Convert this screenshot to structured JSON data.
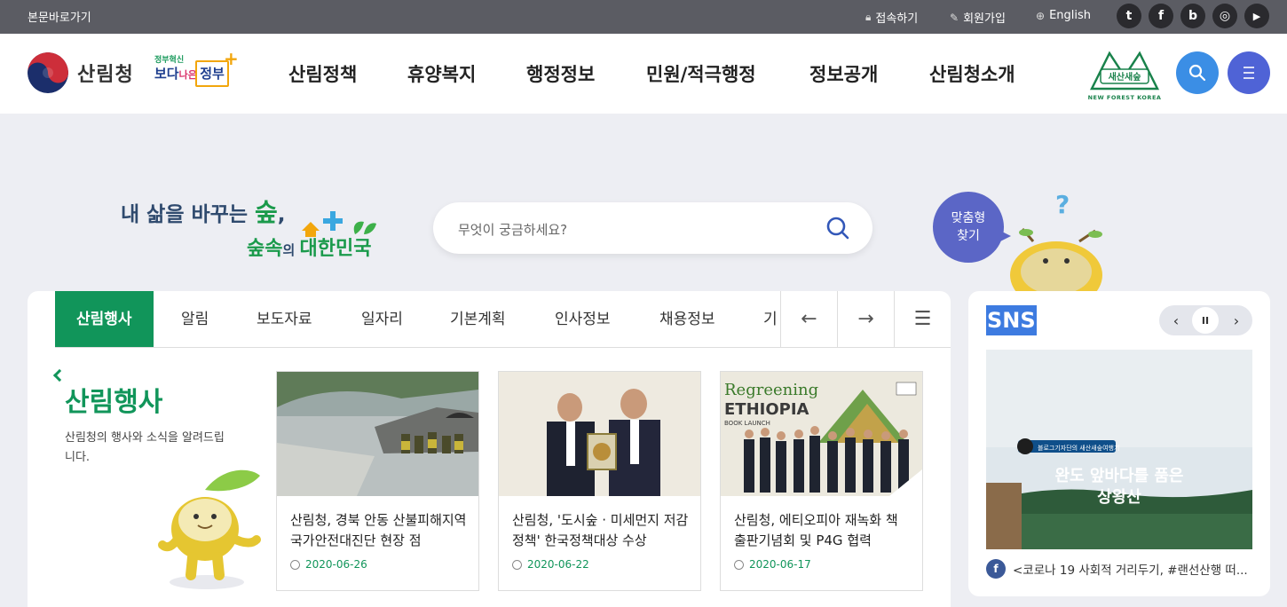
{
  "topbar": {
    "skip_link": "본문바로가기",
    "login": "접속하기",
    "signup": "회원가입",
    "english": "English",
    "social": [
      {
        "name": "twitter",
        "glyph": "t"
      },
      {
        "name": "facebook",
        "glyph": "f"
      },
      {
        "name": "blog",
        "glyph": "b"
      },
      {
        "name": "instagram",
        "glyph": "◎"
      },
      {
        "name": "youtube",
        "glyph": "▶"
      }
    ]
  },
  "header": {
    "logo_text": "산림청",
    "gov_small": "정부혁신",
    "gov_big_1": "보다",
    "gov_big_2": "나은",
    "gov_bracket": "정부",
    "gov_plus": "+",
    "menu": [
      "산림정책",
      "휴양복지",
      "행정정보",
      "민원/적극행정",
      "정보공개",
      "산림청소개"
    ],
    "badge_name": "새산새숲",
    "badge_sub": "NEW FOREST KOREA",
    "search_icon": "search-icon",
    "menu_icon": "hamburger-menu-icon",
    "search_button_color": "#3b8ee5",
    "menu_button_color": "#4f63d6"
  },
  "hero": {
    "slogan_a": "내 삶을 바꾸는 ",
    "slogan_b": "숲",
    "slogan_c": ",",
    "slogan_line2_a": "숲속",
    "slogan_line2_b": "의 ",
    "slogan_line2_c": "대한민국",
    "search_placeholder": "무엇이 궁금하세요?",
    "custom_finder": "맞춤형\n찾기",
    "custom_finder_line1": "맞춤형",
    "custom_finder_line2": "찾기",
    "qmark": "?"
  },
  "board": {
    "tabs": [
      "산림행사",
      "알림",
      "보도자료",
      "일자리",
      "기본계획",
      "인사정보",
      "채용정보",
      "기"
    ],
    "active_tab": "산림행사",
    "prev_icon": "arrow-left-icon",
    "next_icon": "arrow-right-icon",
    "list_icon": "list-icon",
    "prev_glyph": "←",
    "next_glyph": "→",
    "list_glyph": "☰",
    "title": "산림행사",
    "description": "산림청의 행사와 소식을 알려드립니다.",
    "cards": [
      {
        "title": "산림청, 경북 안동 산불피해지역 국가안전대진단 현장 점",
        "date": "2020-06-26"
      },
      {
        "title": "산림청, '도시숲 · 미세먼지 저감 정책' 한국정책대상 수상",
        "date": "2020-06-22"
      },
      {
        "title": "산림청, 에티오피아 재녹화 책 출판기념회 및 P4G 협력",
        "date": "2020-06-17"
      }
    ],
    "card3_sign_line1": "Regreening",
    "card3_sign_line2": "ETHIOPIA",
    "card3_sign_line3": "BOOK LAUNCH"
  },
  "sns": {
    "title": "SNS",
    "prev": "‹",
    "pause": "II",
    "next": "›",
    "image_banner": "블로그기자단의 새산새숲여행기",
    "image_title_1": "완도 앞바다를 품은",
    "image_title_2": "상왕산",
    "caption_icon": "f",
    "caption": "<코로나 19 사회적 거리두기, #랜선산행 떠..."
  }
}
